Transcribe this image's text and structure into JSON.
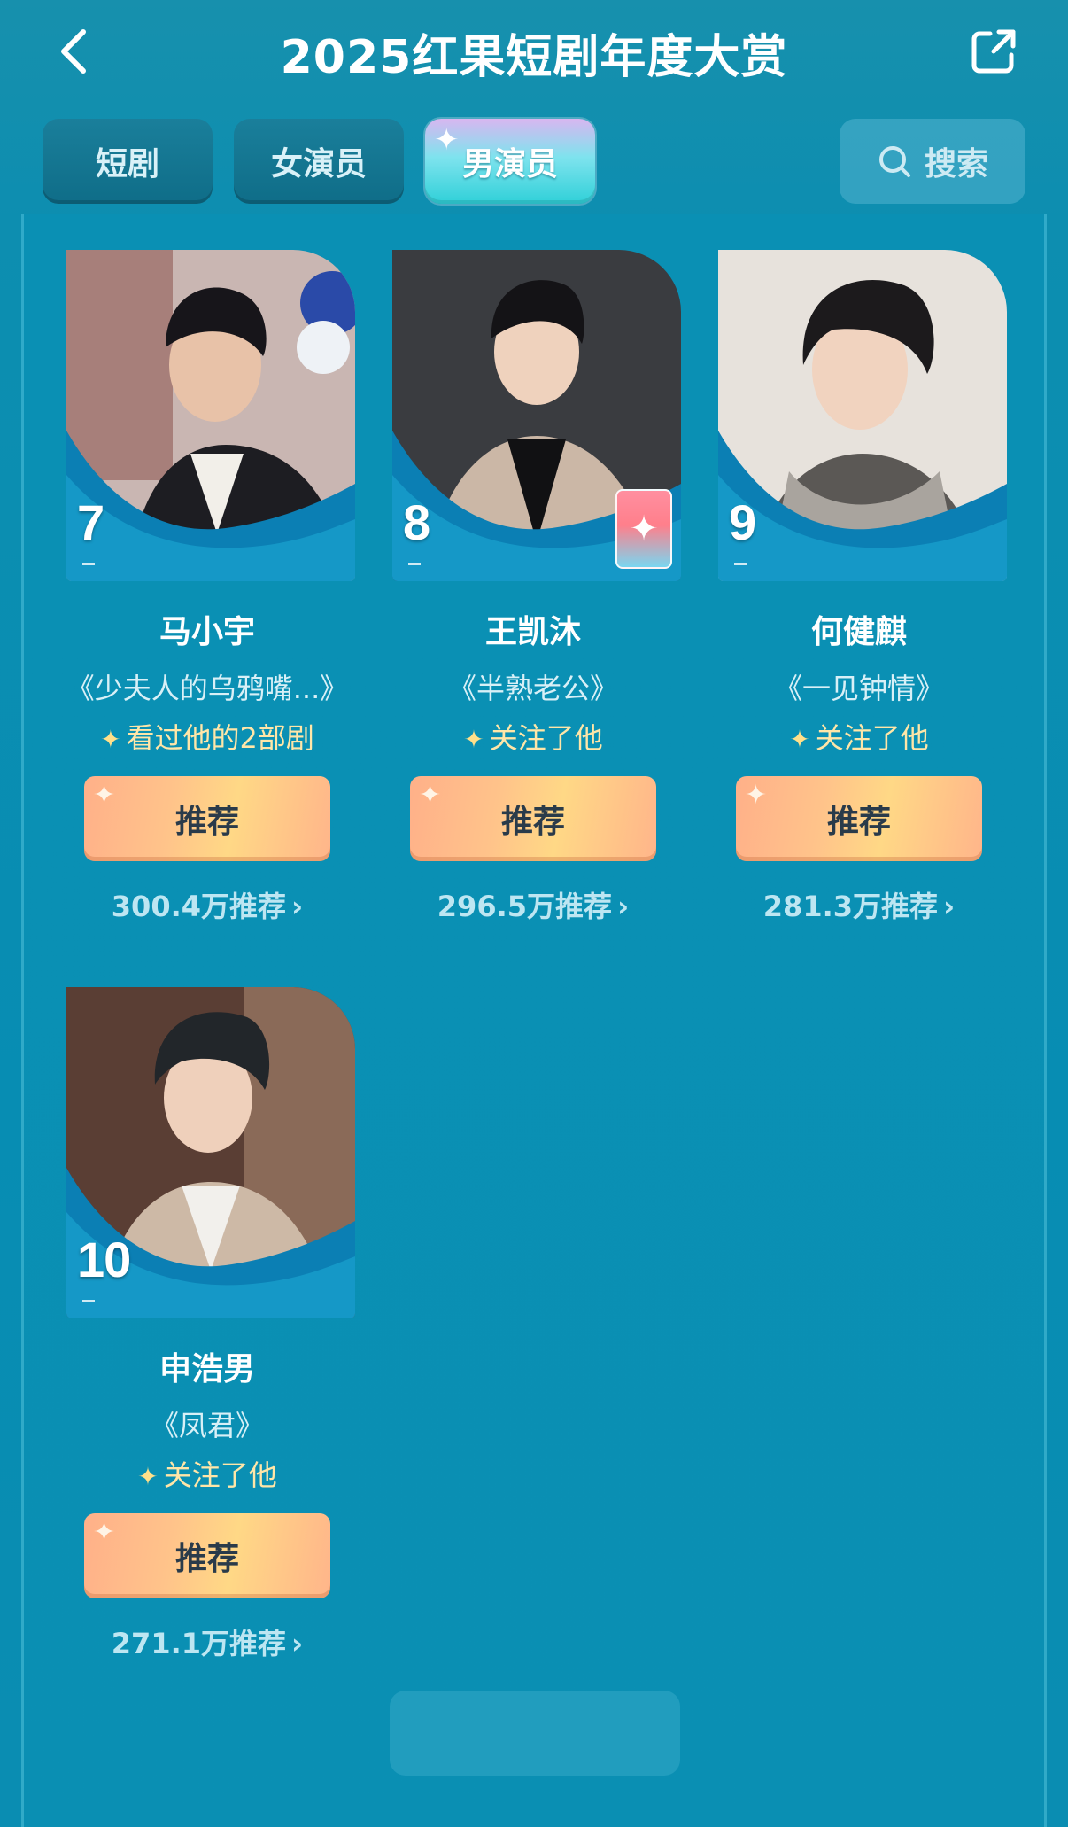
{
  "header": {
    "title": "2025红果短剧年度大赏"
  },
  "tabs": [
    {
      "label": "短剧",
      "active": false
    },
    {
      "label": "女演员",
      "active": false
    },
    {
      "label": "男演员",
      "active": true
    }
  ],
  "search": {
    "label": "搜索"
  },
  "actors": [
    {
      "rank": "7",
      "name": "马小宇",
      "drama": "《少夫人的乌鸦嘴...》",
      "note": "看过他的2部剧",
      "button": "推荐",
      "count": "300.4万推荐"
    },
    {
      "rank": "8",
      "name": "王凯沐",
      "drama": "《半熟老公》",
      "note": "关注了他",
      "button": "推荐",
      "count": "296.5万推荐"
    },
    {
      "rank": "9",
      "name": "何健麒",
      "drama": "《一见钟情》",
      "note": "关注了他",
      "button": "推荐",
      "count": "281.3万推荐"
    },
    {
      "rank": "10",
      "name": "申浩男",
      "drama": "《凤君》",
      "note": "关注了他",
      "button": "推荐",
      "count": "271.1万推荐"
    }
  ],
  "colors": {
    "background": "#0a8fb3",
    "button": "#ffc38a",
    "note": "#ffe6a8"
  }
}
